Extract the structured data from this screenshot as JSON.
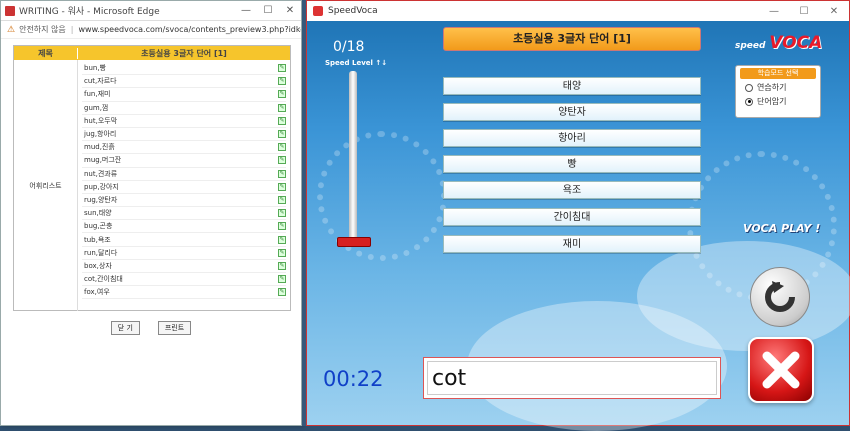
{
  "background": {
    "tab_text": "… speedvoca.com …"
  },
  "edge_window": {
    "title": "WRITING - 워사 - Microsoft Edge",
    "controls": [
      "—",
      "☐",
      "✕"
    ],
    "security": "안전하지 않음",
    "url": "www.speedvoca.com/svoca/contents_preview3.php?idkey…",
    "table": {
      "col_header_1": "제목",
      "col_header_2": "초등실용 3글자 단어 [1]",
      "row_label": "어휘리스트",
      "words": [
        "bun,빵",
        "cut,자르다",
        "fun,재미",
        "gum,껌",
        "hut,오두막",
        "jug,항아리",
        "mud,진흙",
        "mug,머그잔",
        "nut,견과류",
        "pup,강아지",
        "rug,양탄자",
        "sun,태양",
        "bug,곤충",
        "tub,욕조",
        "run,달리다",
        "box,상자",
        "cot,간이침대",
        "fox,여우"
      ]
    },
    "close_btn": "닫 기",
    "print_btn": "프린트"
  },
  "app": {
    "title": "SpeedVoca",
    "controls": [
      "—",
      "☐",
      "✕"
    ],
    "counter": "0/18",
    "speed_label": "Speed Level ↑↓",
    "header": "초등실용 3글자 단어 [1]",
    "choices": [
      "태양",
      "양탄자",
      "항아리",
      "빵",
      "욕조",
      "간이침대",
      "재미"
    ],
    "brand_small": "speed",
    "brand_big": "VOCA",
    "mode_title": "학습모드 선택",
    "mode_options": [
      "연습하기",
      "단어암기"
    ],
    "mode_selected": "단어암기",
    "play_label": "VOCA PLAY !",
    "timer": "00:22",
    "answer_value": "cot"
  }
}
